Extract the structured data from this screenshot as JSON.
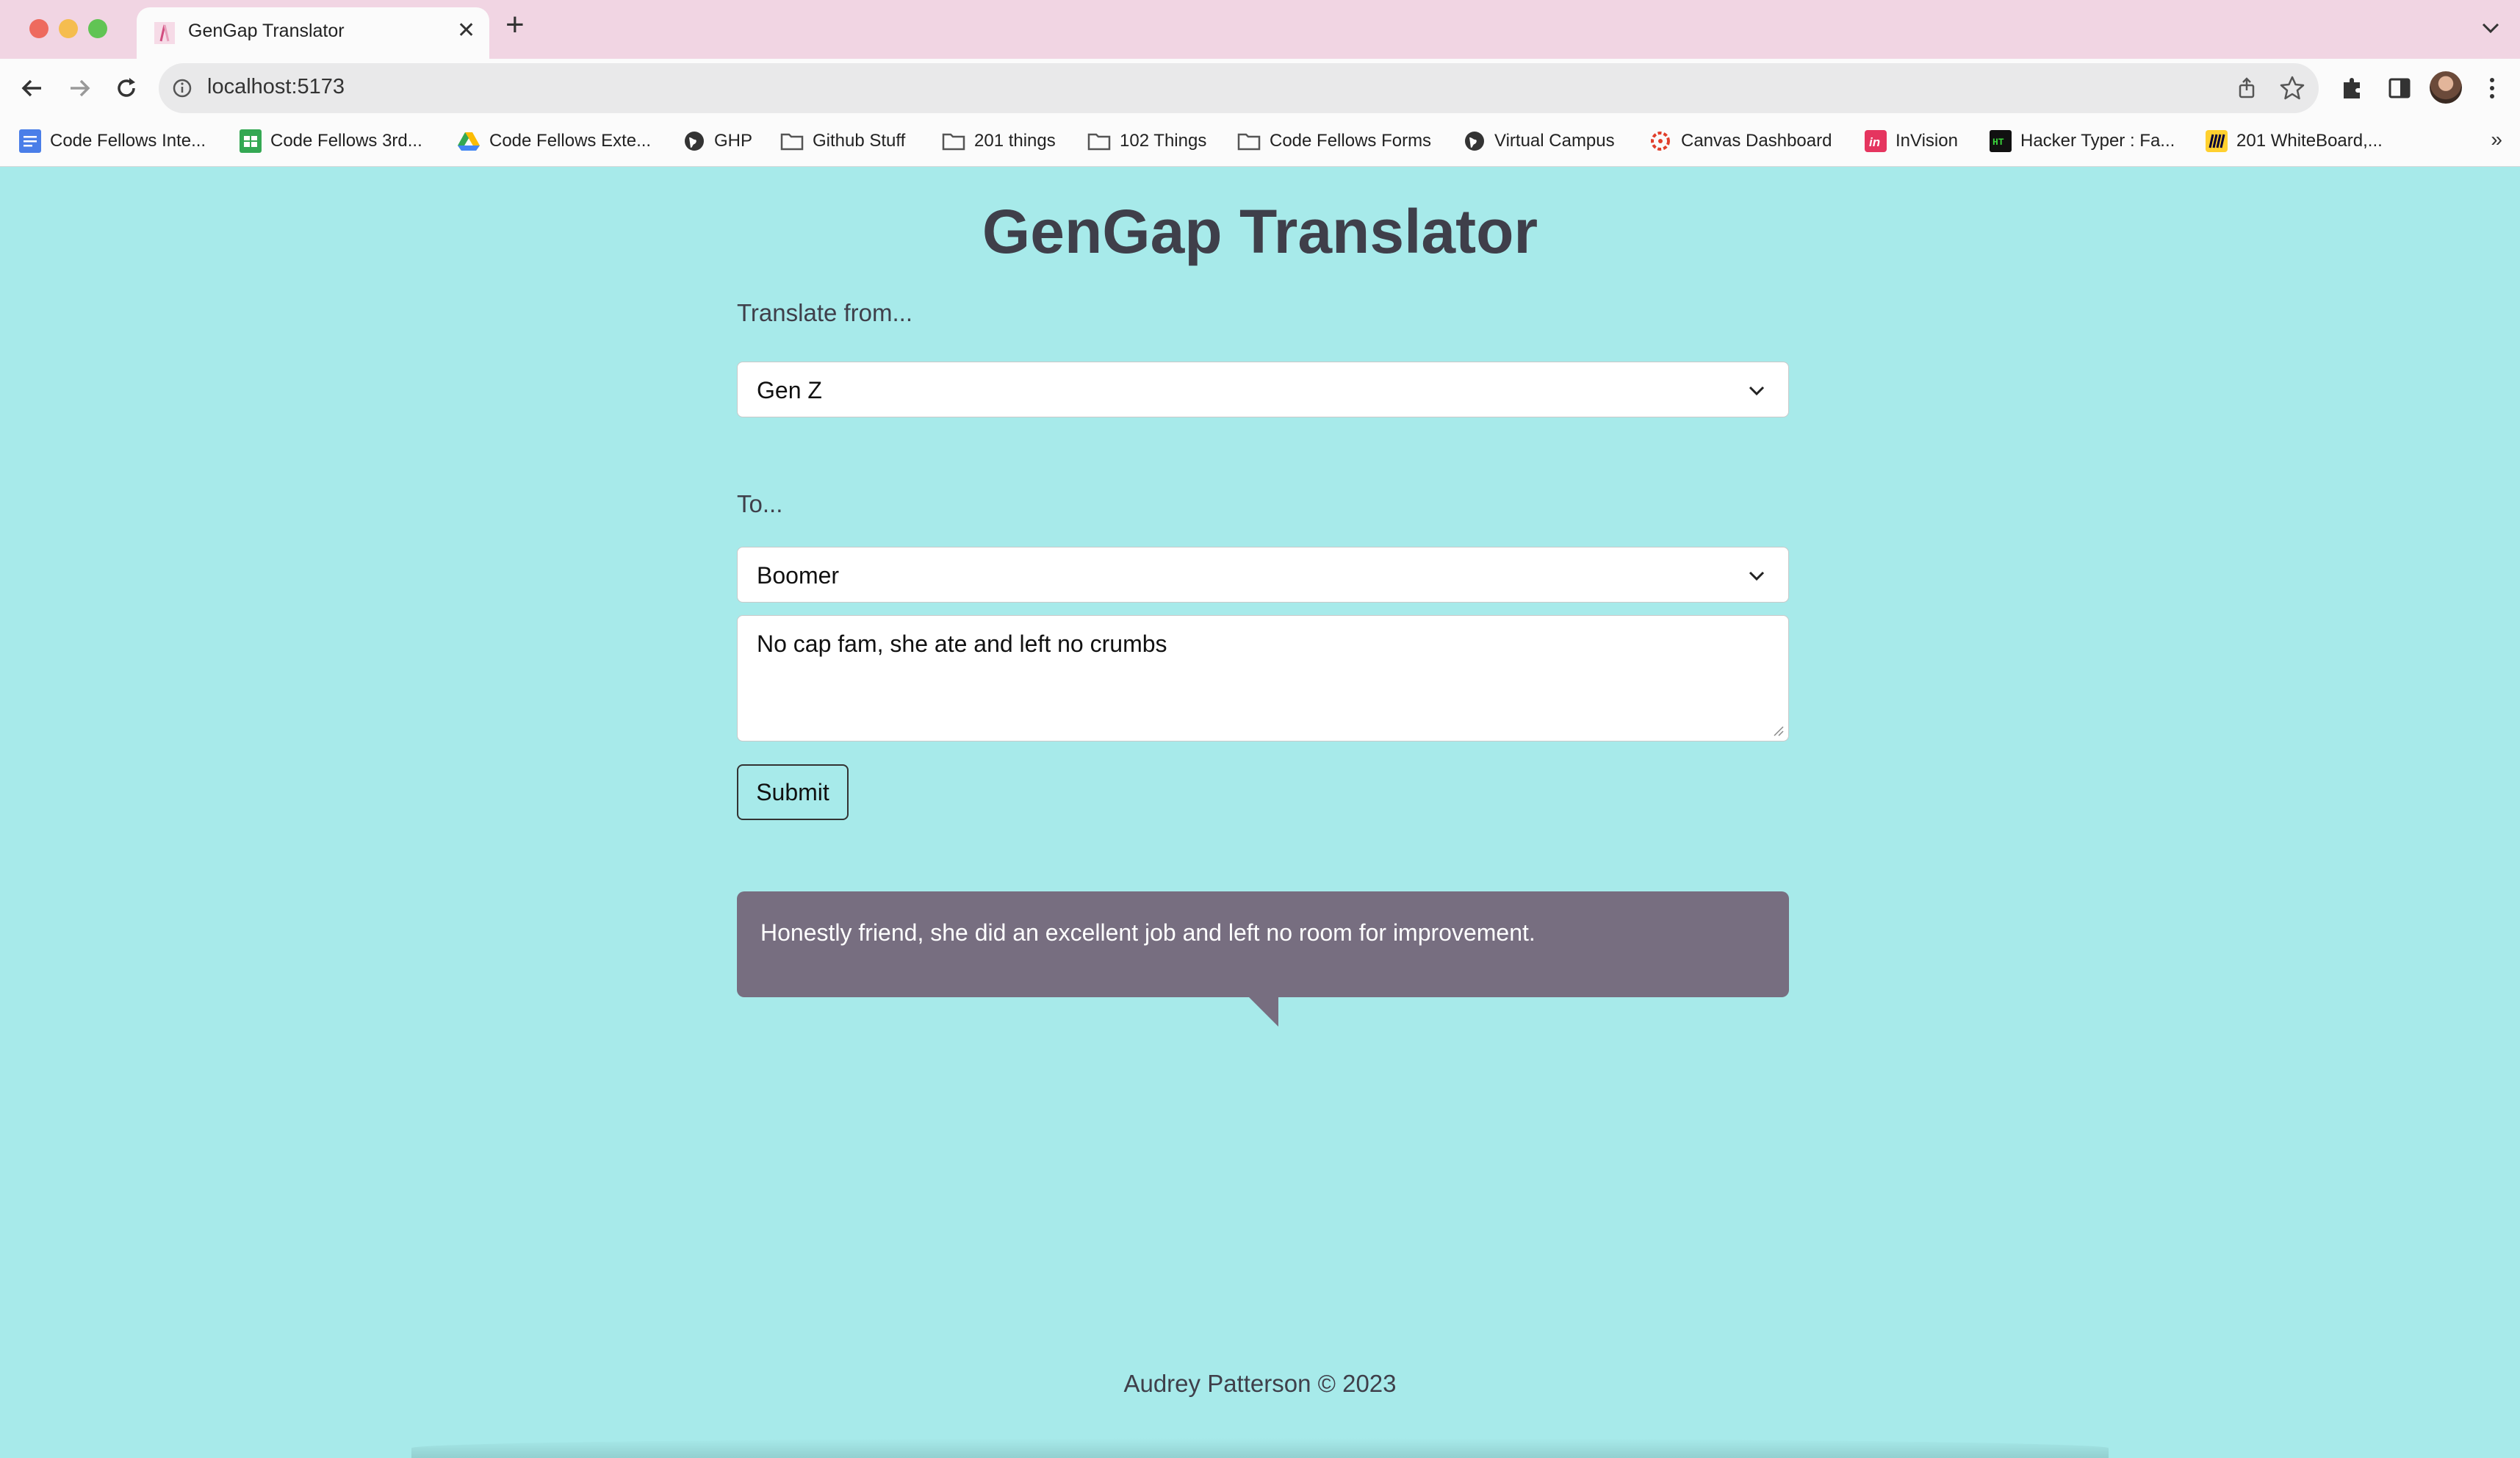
{
  "browser": {
    "tab_title": "GenGap Translator",
    "url": "localhost:5173",
    "bookmarks": [
      {
        "label": "Code Fellows Inte...",
        "icon": "docs-icon"
      },
      {
        "label": "Code Fellows 3rd...",
        "icon": "sheets-icon"
      },
      {
        "label": "Code Fellows Exte...",
        "icon": "drive-icon"
      },
      {
        "label": "GHP",
        "icon": "globe-icon"
      },
      {
        "label": "Github Stuff",
        "icon": "folder-icon"
      },
      {
        "label": "201 things",
        "icon": "folder-icon"
      },
      {
        "label": "102 Things",
        "icon": "folder-icon"
      },
      {
        "label": "Code Fellows Forms",
        "icon": "folder-icon"
      },
      {
        "label": "Virtual Campus",
        "icon": "globe-icon"
      },
      {
        "label": "Canvas Dashboard",
        "icon": "canvas-icon"
      },
      {
        "label": "InVision",
        "icon": "invision-icon"
      },
      {
        "label": "Hacker Typer : Fa...",
        "icon": "hackertyper-icon"
      },
      {
        "label": "201 WhiteBoard,...",
        "icon": "miro-icon"
      }
    ],
    "bookmarks_more": "»"
  },
  "app": {
    "title": "GenGap Translator",
    "from_label": "Translate from...",
    "from_value": "Gen Z",
    "to_label": "To...",
    "to_value": "Boomer",
    "input_text": "No cap fam, she ate and left no crumbs",
    "submit_label": "Submit",
    "output_text": "Honestly friend, she did an excellent job and left no room for improvement.",
    "footer": "Audrey Patterson © 2023"
  },
  "colors": {
    "page_bg": "#a7eaea",
    "heading_text": "#3f3f4a",
    "bubble_bg": "#776e80",
    "tabstrip_bg": "#f1d5e3"
  }
}
